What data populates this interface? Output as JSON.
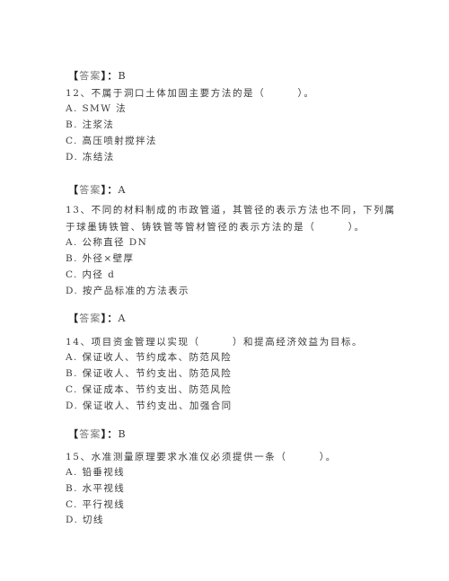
{
  "answer_label_open": "【",
  "answer_label_text": "答案",
  "answer_label_close": "】",
  "answer_sep": "：",
  "blocks": [
    {
      "answer": "B"
    },
    {
      "question_lines": [
        "12、不属于洞口土体加固主要方法的是（　　　）。"
      ],
      "options": [
        "A. SMW 法",
        "B. 注浆法",
        "C. 高压喷射搅拌法",
        "D. 冻结法"
      ],
      "answer": "A"
    },
    {
      "question_lines": [
        "13、不同的材料制成的市政管道，其管径的表示方法也不同，下列属",
        "于球墨铸铁管、铸铁管等管材管径的表示方法的是（　　　）。"
      ],
      "options": [
        "A. 公称直径 DN",
        "B. 外径×壁厚",
        "C. 内径 d",
        "D. 按产品标准的方法表示"
      ],
      "answer": "A"
    },
    {
      "question_lines": [
        "14、项目资金管理以实现（　　　）和提高经济效益为目标。"
      ],
      "options": [
        "A. 保证收人、节约成本、防范风险",
        "B. 保证收人、节约支出、防范风险",
        "C. 保证成本、节约支出、防范风险",
        "D. 保证收人、节约支出、加强合同"
      ],
      "answer": "B"
    },
    {
      "question_lines": [
        "15、水准测量原理要求水准仪必须提供一条（　　　）。"
      ],
      "options": [
        "A. 铅垂视线",
        "B. 水平视线",
        "C. 平行视线",
        "D. 切线"
      ]
    }
  ]
}
